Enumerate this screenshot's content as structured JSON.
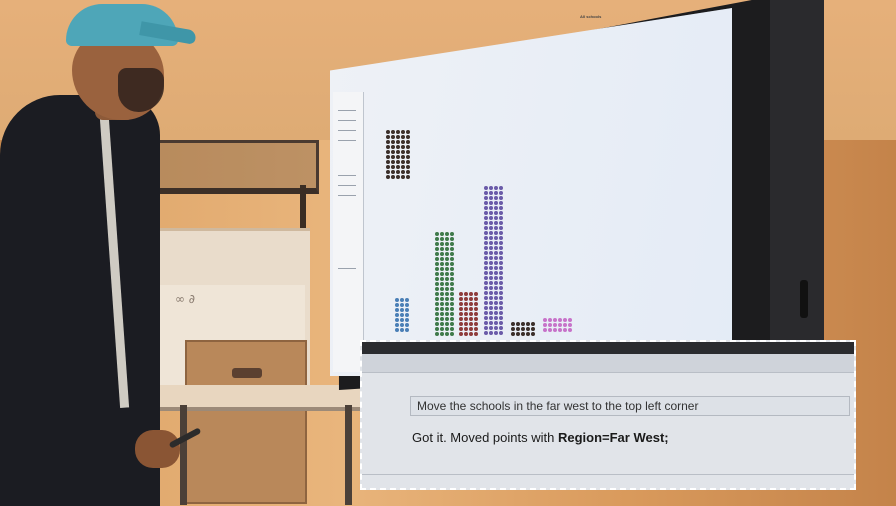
{
  "scene": {
    "screen": {
      "title": "All schools",
      "subtitle": "",
      "message": ""
    },
    "callout": {
      "query": "Move the schools in the far west to the top left corner",
      "reply_prefix": "Got it. Moved points with",
      "reply_bold": "Region=Far West;"
    },
    "colors": {
      "blue": "#4a7fb6",
      "green": "#3f7a4a",
      "red": "#8e3b3b",
      "purple": "#6a5aa8",
      "dark": "#3b2f2a",
      "pink": "#c773c9"
    }
  }
}
